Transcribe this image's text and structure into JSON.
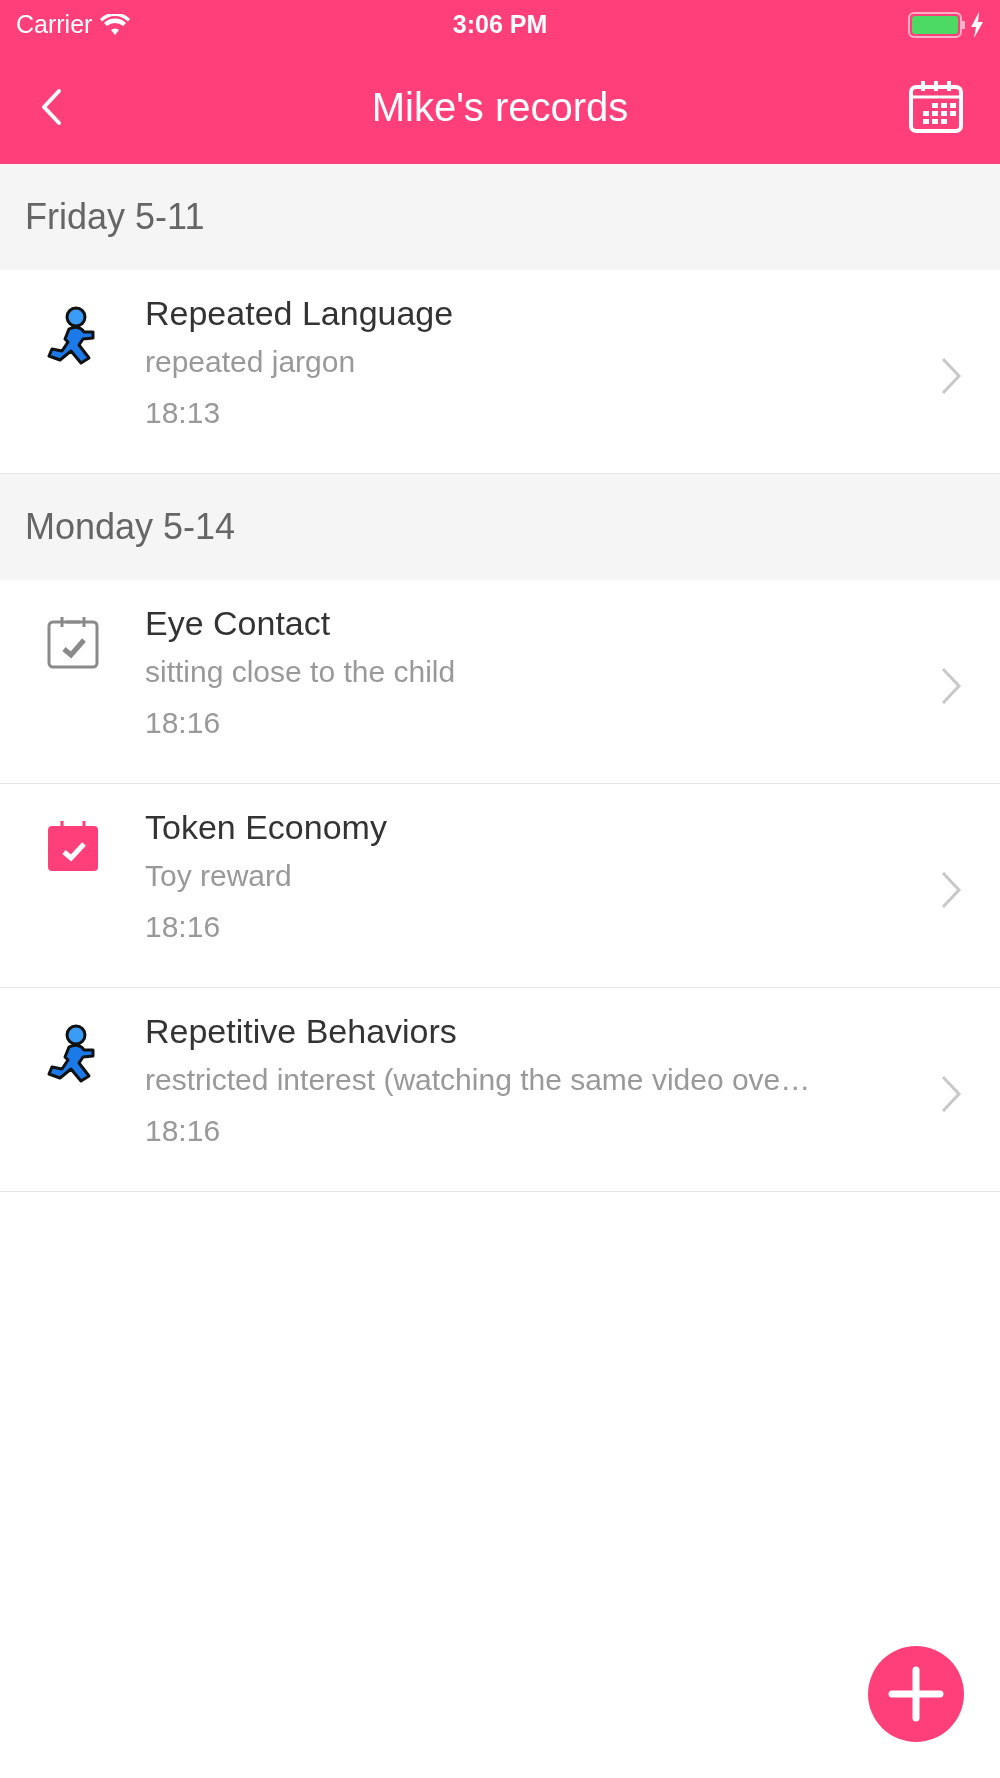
{
  "status_bar": {
    "carrier": "Carrier",
    "time": "3:06 PM"
  },
  "nav_bar": {
    "title": "Mike's records"
  },
  "sections": [
    {
      "date": "Friday 5-11",
      "records": [
        {
          "kind": "runner",
          "title": "Repeated Language",
          "note": "repeated jargon",
          "time": "18:13"
        }
      ]
    },
    {
      "date": "Monday 5-14",
      "records": [
        {
          "kind": "calendar-outline",
          "title": "Eye Contact",
          "note": "sitting close to the child",
          "time": "18:16"
        },
        {
          "kind": "calendar-filled",
          "title": "Token Economy",
          "note": "Toy reward",
          "time": "18:16"
        },
        {
          "kind": "runner",
          "title": "Repetitive Behaviors",
          "note": "restricted interest (watching the same video ove…",
          "time": "18:16"
        }
      ]
    }
  ]
}
